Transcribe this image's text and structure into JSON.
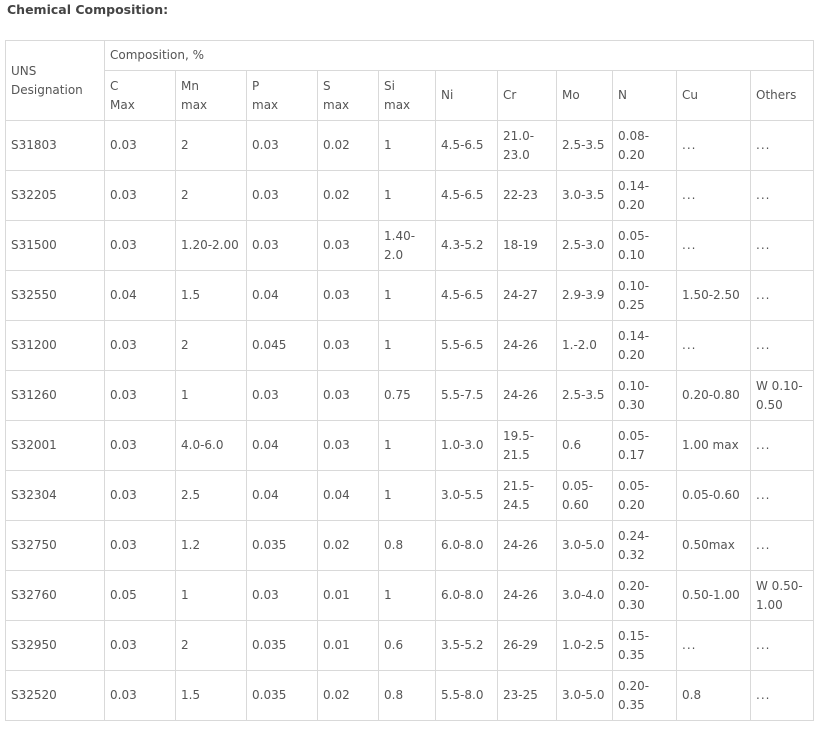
{
  "title": "Chemical Composition:",
  "header": {
    "uns": "UNS Designation",
    "composition": "Composition, %",
    "columns": [
      {
        "line1": "C",
        "line2": "Max"
      },
      {
        "line1": "Mn",
        "line2": "max"
      },
      {
        "line1": "P",
        "line2": "max"
      },
      {
        "line1": "S",
        "line2": "max"
      },
      {
        "line1": "Si",
        "line2": "max"
      },
      {
        "line1": "Ni",
        "line2": ""
      },
      {
        "line1": "Cr",
        "line2": ""
      },
      {
        "line1": "Mo",
        "line2": ""
      },
      {
        "line1": "N",
        "line2": ""
      },
      {
        "line1": "Cu",
        "line2": ""
      },
      {
        "line1": "Others",
        "line2": ""
      }
    ]
  },
  "rows": [
    [
      "S31803",
      "0.03",
      "2",
      "0.03",
      "0.02",
      "1",
      "4.5-6.5",
      "21.0-23.0",
      "2.5-3.5",
      "0.08-0.20",
      "...",
      "..."
    ],
    [
      "S32205",
      "0.03",
      "2",
      "0.03",
      "0.02",
      "1",
      "4.5-6.5",
      "22-23",
      "3.0-3.5",
      "0.14-0.20",
      "...",
      "..."
    ],
    [
      "S31500",
      "0.03",
      "1.20-2.00",
      "0.03",
      "0.03",
      "1.40-2.0",
      "4.3-5.2",
      "18-19",
      "2.5-3.0",
      "0.05-0.10",
      "...",
      "..."
    ],
    [
      "S32550",
      "0.04",
      "1.5",
      "0.04",
      "0.03",
      "1",
      "4.5-6.5",
      "24-27",
      "2.9-3.9",
      "0.10-0.25",
      "1.50-2.50",
      "..."
    ],
    [
      "S31200",
      "0.03",
      "2",
      "0.045",
      "0.03",
      "1",
      "5.5-6.5",
      "24-26",
      "1.-2.0",
      "0.14-0.20",
      "...",
      "..."
    ],
    [
      "S31260",
      "0.03",
      "1",
      "0.03",
      "0.03",
      "0.75",
      "5.5-7.5",
      "24-26",
      "2.5-3.5",
      "0.10-0.30",
      "0.20-0.80",
      "W 0.10-0.50"
    ],
    [
      "S32001",
      "0.03",
      "4.0-6.0",
      "0.04",
      "0.03",
      "1",
      "1.0-3.0",
      "19.5-21.5",
      "0.6",
      "0.05-0.17",
      "1.00 max",
      "..."
    ],
    [
      "S32304",
      "0.03",
      "2.5",
      "0.04",
      "0.04",
      "1",
      "3.0-5.5",
      "21.5-24.5",
      "0.05-0.60",
      "0.05-0.20",
      "0.05-0.60",
      "..."
    ],
    [
      "S32750",
      "0.03",
      "1.2",
      "0.035",
      "0.02",
      "0.8",
      "6.0-8.0",
      "24-26",
      "3.0-5.0",
      "0.24-0.32",
      "0.50max",
      "..."
    ],
    [
      "S32760",
      "0.05",
      "1",
      "0.03",
      "0.01",
      "1",
      "6.0-8.0",
      "24-26",
      "3.0-4.0",
      "0.20-0.30",
      "0.50-1.00",
      "W 0.50-1.00"
    ],
    [
      "S32950",
      "0.03",
      "2",
      "0.035",
      "0.01",
      "0.6",
      "3.5-5.2",
      "26-29",
      "1.0-2.5",
      "0.15-0.35",
      "...",
      "..."
    ],
    [
      "S32520",
      "0.03",
      "1.5",
      "0.035",
      "0.02",
      "0.8",
      "5.5-8.0",
      "23-25",
      "3.0-5.0",
      "0.20-0.35",
      "0.8",
      "..."
    ]
  ]
}
